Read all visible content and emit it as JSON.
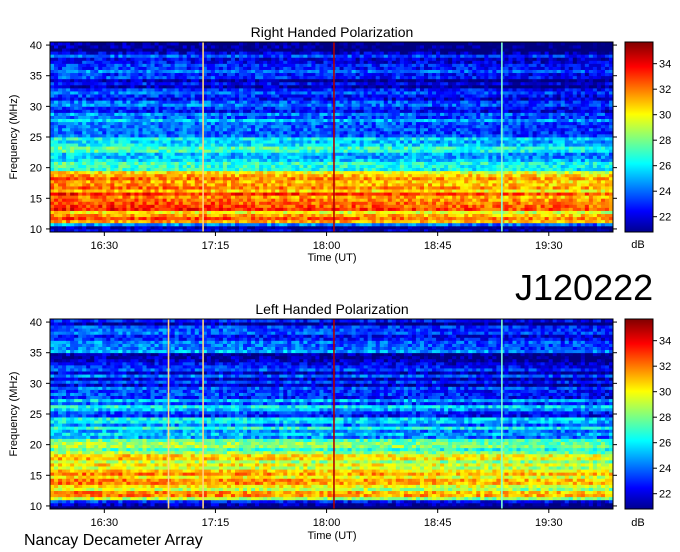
{
  "page": {
    "observation_id": "J120222",
    "footer": "Nancay Decameter Array"
  },
  "chart_data": [
    {
      "type": "heatmap",
      "title": "Right Handed Polarization",
      "xlabel": "Time (UT)",
      "ylabel": "Frequency (MHz)",
      "xticks": [
        "16:30",
        "17:15",
        "18:00",
        "18:45",
        "19:30"
      ],
      "xlim": [
        "16:08",
        "19:56"
      ],
      "yticks": [
        10,
        15,
        20,
        25,
        30,
        35,
        40
      ],
      "ylim": [
        9.5,
        40.5
      ],
      "colorbar": {
        "label": "dB",
        "ticks": [
          22,
          24,
          26,
          28,
          30,
          32,
          34
        ],
        "range": [
          20.8,
          35.7
        ],
        "colormap": "jet"
      },
      "vertical_lines": [
        "17:10",
        "18:03",
        "19:11"
      ],
      "band_profile": [
        [
          10.5,
          22
        ],
        [
          11.5,
          33
        ],
        [
          12.5,
          31
        ],
        [
          13.5,
          33
        ],
        [
          14.5,
          31.5
        ],
        [
          15.5,
          33
        ],
        [
          16.5,
          32
        ],
        [
          17.5,
          33
        ],
        [
          18.5,
          31
        ],
        [
          19.5,
          29
        ],
        [
          20.5,
          27
        ],
        [
          21.5,
          26.5
        ],
        [
          22.5,
          26
        ],
        [
          23.5,
          27
        ],
        [
          24.5,
          26
        ],
        [
          25.5,
          25.5
        ],
        [
          26.5,
          25
        ],
        [
          27.5,
          24.5
        ],
        [
          28.5,
          24.3
        ],
        [
          29.5,
          24
        ],
        [
          30.5,
          23.5
        ],
        [
          31.5,
          23.5
        ],
        [
          32.5,
          23.3
        ],
        [
          33.5,
          23
        ],
        [
          34.5,
          23
        ],
        [
          35.5,
          24
        ],
        [
          36.5,
          24.5
        ],
        [
          37.5,
          23
        ],
        [
          38.5,
          22.8
        ],
        [
          39.5,
          22.5
        ]
      ]
    },
    {
      "type": "heatmap",
      "title": "Left Handed Polarization",
      "xlabel": "Time (UT)",
      "ylabel": "Frequency (MHz)",
      "xticks": [
        "16:30",
        "17:15",
        "18:00",
        "18:45",
        "19:30"
      ],
      "xlim": [
        "16:08",
        "19:56"
      ],
      "yticks": [
        10,
        15,
        20,
        25,
        30,
        35,
        40
      ],
      "ylim": [
        9.5,
        40.5
      ],
      "colorbar": {
        "label": "dB",
        "ticks": [
          22,
          24,
          26,
          28,
          30,
          32,
          34
        ],
        "range": [
          20.8,
          35.7
        ],
        "colormap": "jet"
      },
      "vertical_lines": [
        "16:56",
        "17:10",
        "18:03",
        "19:11"
      ],
      "band_profile": [
        [
          10.5,
          22
        ],
        [
          11.5,
          33
        ],
        [
          12.5,
          30.5
        ],
        [
          13.5,
          32.5
        ],
        [
          14.5,
          30.5
        ],
        [
          15.5,
          31.5
        ],
        [
          16.5,
          30
        ],
        [
          17.5,
          31
        ],
        [
          18.5,
          29
        ],
        [
          19.5,
          28
        ],
        [
          20.5,
          27
        ],
        [
          21.5,
          26.5
        ],
        [
          22.5,
          26
        ],
        [
          23.5,
          25.5
        ],
        [
          24.5,
          25
        ],
        [
          25.5,
          24.8
        ],
        [
          26.5,
          25.5
        ],
        [
          27.5,
          24.5
        ],
        [
          28.5,
          24
        ],
        [
          29.5,
          23.8
        ],
        [
          30.5,
          23.5
        ],
        [
          31.5,
          23.3
        ],
        [
          32.5,
          23.2
        ],
        [
          33.5,
          23
        ],
        [
          34.5,
          23
        ],
        [
          35.5,
          24.5
        ],
        [
          36.5,
          25
        ],
        [
          37.5,
          24
        ],
        [
          38.5,
          23.5
        ],
        [
          39.5,
          23.2
        ]
      ]
    }
  ]
}
